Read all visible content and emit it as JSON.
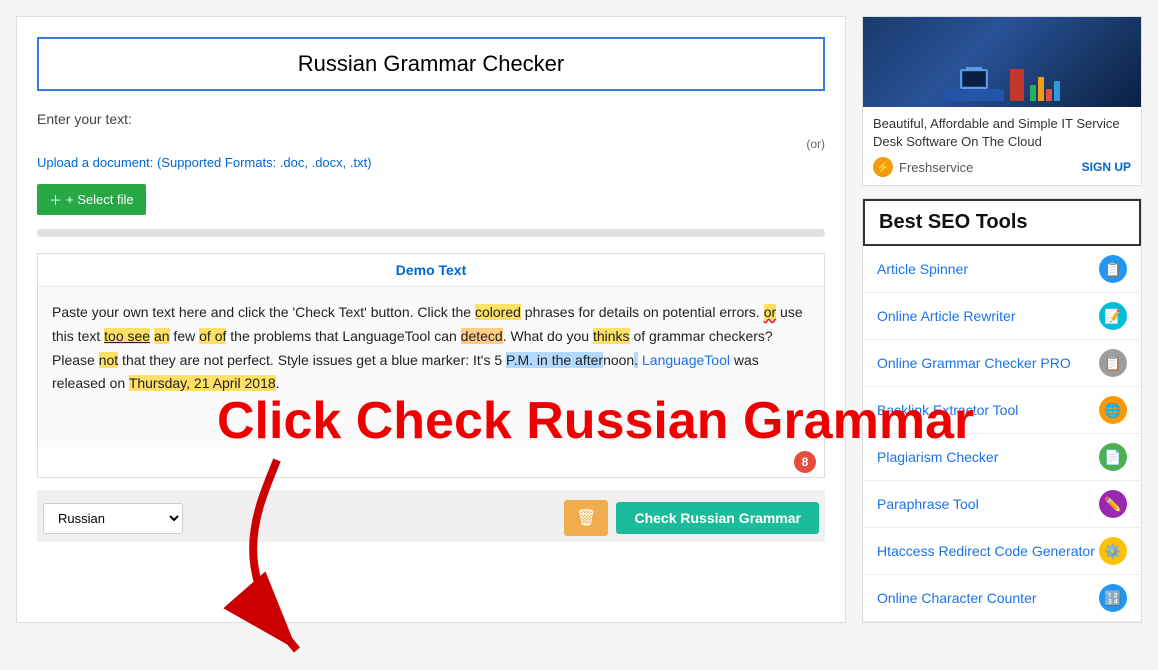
{
  "page": {
    "title": "Russian Grammar Checker",
    "enter_text_label": "Enter your text:",
    "or_text": "(or)",
    "upload_label": "Upload a document: (Supported Formats: .doc, .docx, .txt)",
    "select_file_btn": "+ Select file",
    "demo_text_header": "Demo Text",
    "demo_text": "Paste your own text here and click the 'Check Text' button. Click the colored phrases for details on potential errors.",
    "language": "Russian",
    "trash_icon": "🗑",
    "check_btn": "Check Russian Grammar",
    "badge_count": "8",
    "overlay_text": "Click Check Russian Grammar"
  },
  "sidebar": {
    "ad": {
      "headline": "Beautiful, Affordable and Simple IT Service Desk Software On The Cloud",
      "brand": "Freshservice",
      "signup": "SIGN UP"
    },
    "seo_tools_header": "Best SEO Tools",
    "tools": [
      {
        "label": "Article Spinner",
        "icon": "📋",
        "icon_class": "icon-blue"
      },
      {
        "label": "Online Article Rewriter",
        "icon": "📝",
        "icon_class": "icon-teal"
      },
      {
        "label": "Online Grammar Checker PRO",
        "icon": "📋",
        "icon_class": "icon-gray"
      },
      {
        "label": "Backlink Extractor Tool",
        "icon": "🌐",
        "icon_class": "icon-orange"
      },
      {
        "label": "Plagiarism Checker",
        "icon": "📄",
        "icon_class": "icon-green"
      },
      {
        "label": "Paraphrase Tool",
        "icon": "✏️",
        "icon_class": "icon-purple"
      },
      {
        "label": "Htaccess Redirect Code Generator",
        "icon": "⚙️",
        "icon_class": "icon-yellow"
      },
      {
        "label": "Online Character Counter",
        "icon": "🔢",
        "icon_class": "icon-blue"
      }
    ]
  }
}
